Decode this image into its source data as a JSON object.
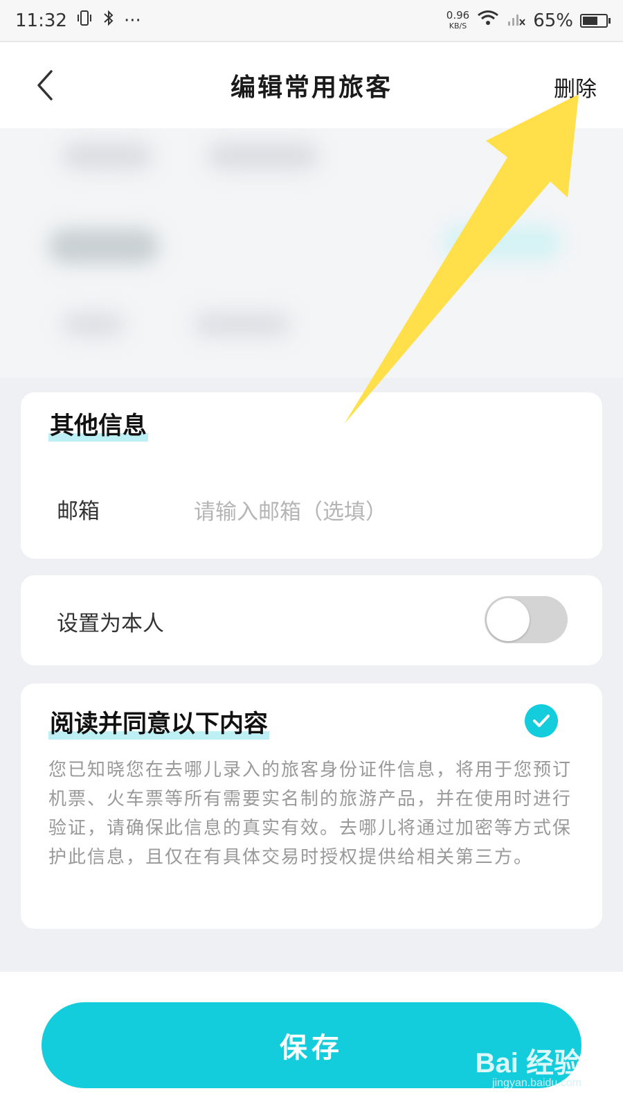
{
  "status_bar": {
    "time": "11:32",
    "more": "···",
    "net_speed": "0.96",
    "net_unit": "KB/S",
    "battery": "65%",
    "battery_level": 0.65
  },
  "nav": {
    "title": "编辑常用旅客",
    "delete_label": "删除"
  },
  "other_info": {
    "title": "其他信息",
    "email_label": "邮箱",
    "email_placeholder": "请输入邮箱（选填）",
    "email_value": ""
  },
  "set_self": {
    "label": "设置为本人",
    "toggle_on": false
  },
  "agreement": {
    "title": "阅读并同意以下内容",
    "checked": true,
    "text": "您已知晓您在去哪儿录入的旅客身份证件信息，将用于您预订机票、火车票等所有需要实名制的旅游产品，并在使用时进行验证，请确保此信息的真实有效。去哪儿将通过加密等方式保护此信息，且仅在有具体交易时授权提供给相关第三方。"
  },
  "footer": {
    "save_label": "保存",
    "watermark": "Bai 经验",
    "watermark_url": "jingyan.baidu.com"
  },
  "colors": {
    "accent": "#14cddc",
    "arrow": "#ffdf4a",
    "highlight": "#bdf0f5"
  }
}
